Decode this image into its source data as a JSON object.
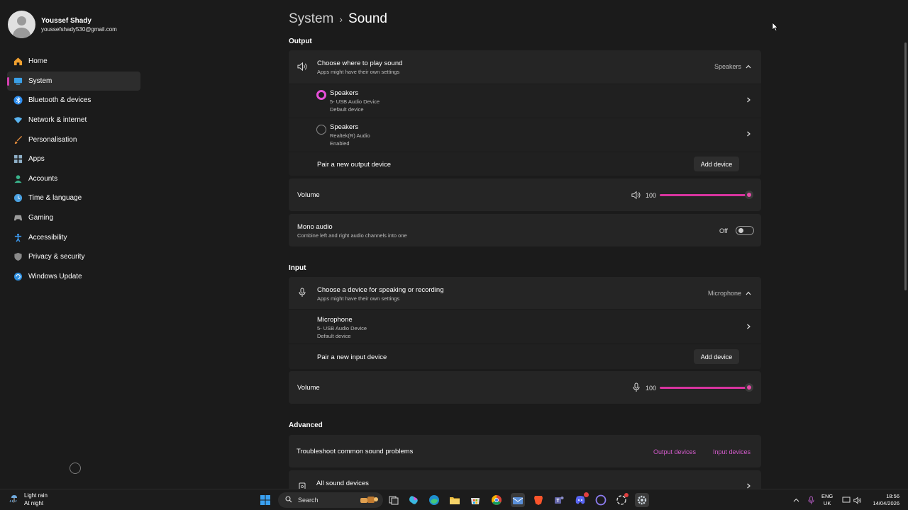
{
  "profile": {
    "name": "Youssef Shady",
    "email": "youssefshady530@gmail.com"
  },
  "sidebar": {
    "items": [
      {
        "label": "Home",
        "icon": "home-icon",
        "color": "#f0a030"
      },
      {
        "label": "System",
        "icon": "system-icon",
        "color": "#3aa0e8",
        "active": true
      },
      {
        "label": "Bluetooth & devices",
        "icon": "bluetooth-icon",
        "color": "#2f8ff0"
      },
      {
        "label": "Network & internet",
        "icon": "network-icon",
        "color": "#5ab4f0"
      },
      {
        "label": "Personalisation",
        "icon": "brush-icon",
        "color": "#e08a3c"
      },
      {
        "label": "Apps",
        "icon": "apps-icon",
        "color": "#8fb0c8"
      },
      {
        "label": "Accounts",
        "icon": "accounts-icon",
        "color": "#3ab48c"
      },
      {
        "label": "Time & language",
        "icon": "globe-clock-icon",
        "color": "#4aa0e0"
      },
      {
        "label": "Gaming",
        "icon": "gaming-icon",
        "color": "#9a9a9a"
      },
      {
        "label": "Accessibility",
        "icon": "accessibility-icon",
        "color": "#3c9af0"
      },
      {
        "label": "Privacy & security",
        "icon": "shield-icon",
        "color": "#8a8a8a"
      },
      {
        "label": "Windows Update",
        "icon": "update-icon",
        "color": "#2e8fe0"
      }
    ]
  },
  "breadcrumb": {
    "parent": "System",
    "separator": "›",
    "current": "Sound"
  },
  "output": {
    "section_label": "Output",
    "choose": {
      "title": "Choose where to play sound",
      "subtitle": "Apps might have their own settings",
      "selected": "Speakers"
    },
    "devices": [
      {
        "name": "Speakers",
        "line1": "5- USB Audio Device",
        "line2": "Default device",
        "selected": true
      },
      {
        "name": "Speakers",
        "line1": "Realtek(R) Audio",
        "line2": "Enabled",
        "selected": false
      }
    ],
    "pair": {
      "label": "Pair a new output device",
      "button": "Add device"
    },
    "volume": {
      "label": "Volume",
      "value": "100",
      "level": 1.0
    },
    "mono": {
      "title": "Mono audio",
      "subtitle": "Combine left and right audio channels into one",
      "state": "Off"
    }
  },
  "input": {
    "section_label": "Input",
    "choose": {
      "title": "Choose a device for speaking or recording",
      "subtitle": "Apps might have their own settings",
      "selected": "Microphone"
    },
    "devices": [
      {
        "name": "Microphone",
        "line1": "5- USB Audio Device",
        "line2": "Default device"
      }
    ],
    "pair": {
      "label": "Pair a new input device",
      "button": "Add device"
    },
    "volume": {
      "label": "Volume",
      "value": "100",
      "level": 1.0
    }
  },
  "advanced": {
    "section_label": "Advanced",
    "troubleshoot": {
      "label": "Troubleshoot common sound problems",
      "output_link": "Output devices",
      "input_link": "Input devices"
    },
    "all_devices": {
      "label": "All sound devices"
    }
  },
  "taskbar": {
    "weather": {
      "line1": "Light rain",
      "line2": "At night"
    },
    "search_placeholder": "Search",
    "lang": {
      "line1": "ENG",
      "line2": "UK"
    },
    "clock": {
      "time": "18:56",
      "date": "14/04/2026"
    }
  },
  "colors": {
    "accent": "#d8349f",
    "background": "#1b1b1b",
    "card": "#252525"
  }
}
